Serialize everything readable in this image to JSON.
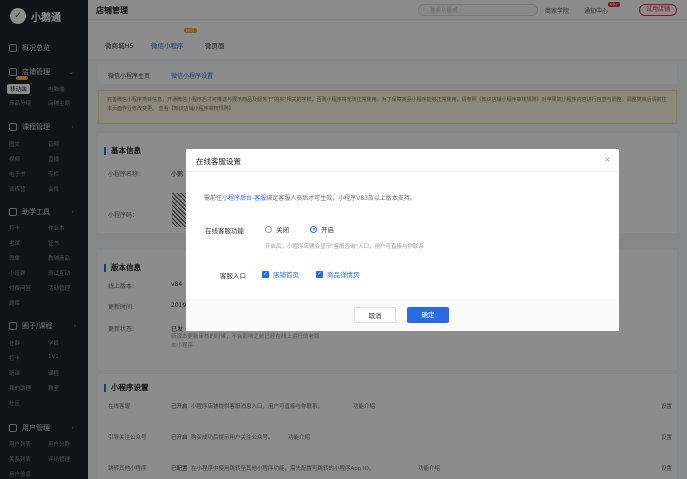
{
  "app": {
    "name": "小鹅通"
  },
  "header": {
    "title": "店铺管理",
    "search_placeholder": "搜索功能或",
    "links": [
      "商家学院",
      "通知中心",
      "试用店铺"
    ],
    "badge": "99+"
  },
  "sidebar": {
    "sections": [
      {
        "label": "概况总览"
      },
      {
        "label": "店铺管理"
      },
      {
        "label": "课程管理"
      },
      {
        "label": "助学工具"
      },
      {
        "label": "圈子/课程"
      },
      {
        "label": "用户管理"
      }
    ],
    "items": [
      {
        "label": "移动端"
      },
      {
        "label": "电脑端"
      },
      {
        "label": "商品分组"
      },
      {
        "label": "店铺主题"
      },
      {
        "label": "图文"
      },
      {
        "label": "音频"
      },
      {
        "label": "视频"
      },
      {
        "label": "直播"
      },
      {
        "label": "电子书"
      },
      {
        "label": "专栏"
      },
      {
        "label": "训练营"
      },
      {
        "label": "会员"
      },
      {
        "label": "打卡"
      },
      {
        "label": "作业本"
      },
      {
        "label": "考试"
      },
      {
        "label": "证书"
      },
      {
        "label": "表单"
      },
      {
        "label": "教辅商品"
      },
      {
        "label": "小班群"
      },
      {
        "label": "测试互动"
      },
      {
        "label": "付费问答"
      },
      {
        "label": "活动管理"
      },
      {
        "label": "题库"
      },
      {
        "label": "社群"
      },
      {
        "label": "学员"
      },
      {
        "label": "打卡"
      },
      {
        "label": "1V1"
      },
      {
        "label": "班课"
      },
      {
        "label": "课程"
      },
      {
        "label": "我的助理"
      },
      {
        "label": "教室"
      },
      {
        "label": "社区"
      },
      {
        "label": "用户列表"
      },
      {
        "label": "用户分群"
      },
      {
        "label": "关系列表"
      },
      {
        "label": "评论管理"
      },
      {
        "label": "用户信息"
      }
    ],
    "new_badge": "NEW"
  },
  "tabs": [
    {
      "label": "微商城H5"
    },
    {
      "label": "微信小程序",
      "badge": "HOT"
    },
    {
      "label": "微页面"
    }
  ],
  "subtabs": [
    "微信小程序主页",
    "微信小程序设置"
  ],
  "notice": "完善微信小程序类目信息，开通微信小程序后才可推送与展示商品及服务于\"购买\"相关的字样，否则小程序将无法正常使用。为了保障商品小程序能够正常使用，请参照《知识店铺小程序审核规则》对苹果端小程序内容进行自查与调整。调整类目后请前往本页面作业修改变更。 查看【知识店铺小程序审核规则】",
  "basic_info": {
    "title": "基本信息",
    "name_label": "小程序名称:",
    "name_value": "小鹅",
    "code_label": "小程序码："
  },
  "version_info": {
    "title": "版本信息",
    "online_label": "线上版本:",
    "online_value": "v84",
    "updated_label": "更新时间:",
    "updated_value": "2019",
    "status_label": "更新状态:",
    "status_value": "已发",
    "status_note": "新版本更新审核的时候，不会影响之前已经在线上运行的老版本小程序"
  },
  "settings": {
    "title": "小程序设置",
    "rows": [
      {
        "label": "在线客服",
        "status": "已开启",
        "desc": "小程序店铺提供客服消息入口，用户可直接与你联系。",
        "link": "功能介绍",
        "action": "设置"
      },
      {
        "label": "引导关注公众号",
        "status": "已开启",
        "desc": "购买成功后提示用户关注公众号。",
        "link": "功能介绍",
        "action": "设置"
      },
      {
        "label": "跳转其他小程序",
        "status": "已配置",
        "desc": "在小程序中使用跳转至其他小程序功能，需先配置可跳转的小程序App ID。",
        "link": "功能介绍",
        "action": "设置"
      }
    ]
  },
  "modal": {
    "title": "在线客服设置",
    "close": "×",
    "desc_prefix": "需前往",
    "desc_link": "小程序后台-客服",
    "desc_suffix": "绑定客服人员后才可生效，小程序V83及以上版本支持。",
    "func_label": "在线客服功能",
    "opt_off": "关闭",
    "opt_on": "开启",
    "hint": "开启后，小程序店铺会显示\"客服咨询\"入口，用户可直接与你联系",
    "entry_label": "客服入口",
    "entry_home": "店铺首页",
    "entry_detail": "商品详情页",
    "cancel": "取消",
    "ok": "确定"
  }
}
